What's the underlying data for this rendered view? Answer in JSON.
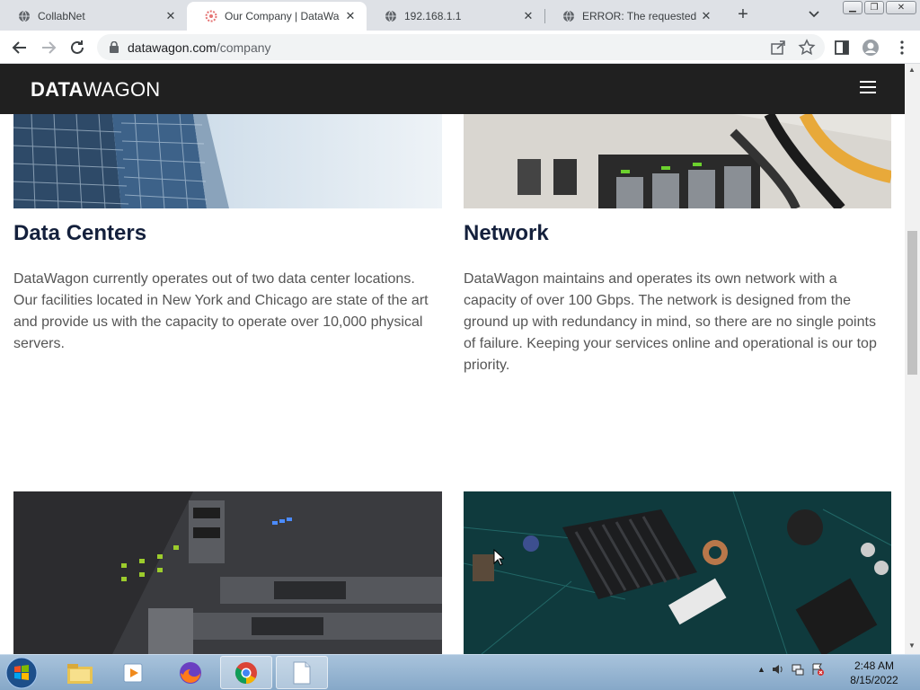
{
  "browser": {
    "tabs": [
      {
        "title": "CollabNet",
        "active": false,
        "icon": "globe-icon"
      },
      {
        "title": "Our Company | DataWagon",
        "active": true,
        "icon": "datawagon-favicon"
      },
      {
        "title": "192.168.1.1",
        "active": false,
        "icon": "globe-icon"
      },
      {
        "title": "ERROR: The requested URL could not be retrieved",
        "active": false,
        "icon": "globe-icon"
      }
    ],
    "new_tab_label": "+",
    "url_domain": "datawagon.com",
    "url_path": "/company"
  },
  "site": {
    "logo_bold": "DATA",
    "logo_light": "WAGON",
    "sections": [
      {
        "heading": "Data Centers",
        "text": "DataWagon currently operates out of two data center locations. Our facilities located in New York and Chicago are state of the art and provide us with the capacity to operate over 10,000 physical servers."
      },
      {
        "heading": "Network",
        "text": "DataWagon maintains and operates its own network with a capacity of over 100 Gbps. The network is designed from the ground up with redundancy in mind, so there are no single points of failure. Keeping your services online and operational is our top priority."
      }
    ]
  },
  "taskbar": {
    "time": "2:48 AM",
    "date": "8/15/2022",
    "apps": [
      "file-explorer-icon",
      "media-player-icon",
      "firefox-icon",
      "chrome-icon",
      "notepad-icon"
    ]
  },
  "colors": {
    "nav_bg": "#202020",
    "heading": "#14203c",
    "body_text": "#555555"
  }
}
